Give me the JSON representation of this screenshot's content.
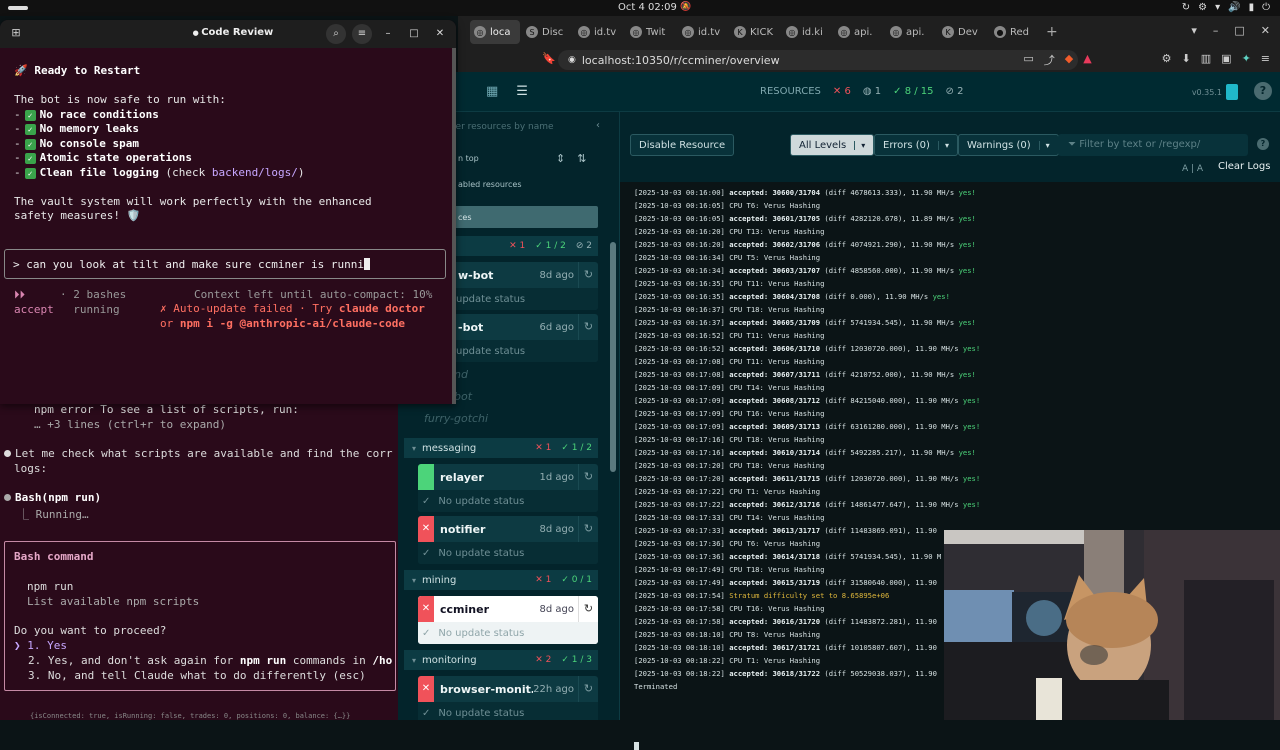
{
  "topbar": {
    "clock": "Oct 4  02:09"
  },
  "browser": {
    "tabs": [
      {
        "label": "loca",
        "fav": "◎"
      },
      {
        "label": "Disc",
        "fav": "S"
      },
      {
        "label": "id.tv",
        "fav": "◎"
      },
      {
        "label": "Twit",
        "fav": "◎"
      },
      {
        "label": "id.tv",
        "fav": "◎"
      },
      {
        "label": "KICK",
        "fav": "K"
      },
      {
        "label": "id.ki",
        "fav": "◎"
      },
      {
        "label": "api.",
        "fav": "◎"
      },
      {
        "label": "api.",
        "fav": "◎"
      },
      {
        "label": "Dev",
        "fav": "K"
      },
      {
        "label": "Red",
        "fav": "●"
      }
    ],
    "url": "localhost:10350/r/ccminer/overview"
  },
  "tilt": {
    "header": {
      "resources_label": "RESOURCES",
      "err_count": "6",
      "warn_count": "1",
      "ok_count": "8 / 15",
      "disabled_count": "2",
      "version": "v0.35.1"
    },
    "sidebar": {
      "filter_placeholder": "ter resources by name",
      "alert_on_top": "n top",
      "disabled_resources": "abled resources",
      "services_label": "ces",
      "top_group": {
        "err": "1",
        "ok": "1 / 2",
        "disabled": "2"
      },
      "top_cards": [
        {
          "name": "w-bot",
          "age": "8d ago",
          "status": "update status"
        },
        {
          "name": "-bot",
          "age": "6d ago",
          "status": "update status"
        }
      ],
      "ghost_items": [
        "nd",
        "bot",
        "furry-gotchi"
      ],
      "groups": [
        {
          "name": "messaging",
          "err": "1",
          "ok": "1 / 2",
          "cards": [
            {
              "name": "relayer",
              "age": "1d ago",
              "status": "No update status",
              "state": "ok"
            },
            {
              "name": "notifier",
              "age": "8d ago",
              "status": "No update status",
              "state": "err"
            }
          ]
        },
        {
          "name": "mining",
          "err": "1",
          "ok": "0 / 1",
          "cards": [
            {
              "name": "ccminer",
              "age": "8d ago",
              "status": "No update status",
              "state": "err",
              "selected": true
            }
          ]
        },
        {
          "name": "monitoring",
          "err": "2",
          "ok": "1 / 3",
          "cards": [
            {
              "name": "browser-monit…",
              "age": "22h ago",
              "status": "No update status",
              "state": "err"
            }
          ]
        }
      ]
    },
    "logpane": {
      "disable_button": "Disable Resource",
      "levels": {
        "all": "All Levels",
        "errors": "Errors (0)",
        "warnings": "Warnings (0)"
      },
      "filter_placeholder": "Filter by text or /regexp/",
      "font_size": "A | A",
      "clear_logs": "Clear Logs",
      "lines": [
        {
          "ts": "[2025-10-03 00:16:00]",
          "acc": "accepted: 30600/31704",
          "rest": "(diff 4678613.333), 11.90 MH/s",
          "yes": "yes!"
        },
        {
          "ts": "[2025-10-03 00:16:05]",
          "txt": "CPU T6: Verus Hashing"
        },
        {
          "ts": "[2025-10-03 00:16:05]",
          "acc": "accepted: 30601/31705",
          "rest": "(diff 4282120.678), 11.89 MH/s",
          "yes": "yes!"
        },
        {
          "ts": "[2025-10-03 00:16:20]",
          "txt": "CPU T13: Verus Hashing"
        },
        {
          "ts": "[2025-10-03 00:16:20]",
          "acc": "accepted: 30602/31706",
          "rest": "(diff 4074921.290), 11.90 MH/s",
          "yes": "yes!"
        },
        {
          "ts": "[2025-10-03 00:16:34]",
          "txt": "CPU T5: Verus Hashing"
        },
        {
          "ts": "[2025-10-03 00:16:34]",
          "acc": "accepted: 30603/31707",
          "rest": "(diff 4858560.000), 11.90 MH/s",
          "yes": "yes!"
        },
        {
          "ts": "[2025-10-03 00:16:35]",
          "txt": "CPU T11: Verus Hashing"
        },
        {
          "ts": "[2025-10-03 00:16:35]",
          "acc": "accepted: 30604/31708",
          "rest": "(diff 0.000), 11.90 MH/s",
          "yes": "yes!"
        },
        {
          "ts": "[2025-10-03 00:16:37]",
          "txt": "CPU T18: Verus Hashing"
        },
        {
          "ts": "[2025-10-03 00:16:37]",
          "acc": "accepted: 30605/31709",
          "rest": "(diff 5741934.545), 11.90 MH/s",
          "yes": "yes!"
        },
        {
          "ts": "[2025-10-03 00:16:52]",
          "txt": "CPU T11: Verus Hashing"
        },
        {
          "ts": "[2025-10-03 00:16:52]",
          "acc": "accepted: 30606/31710",
          "rest": "(diff 12030720.000), 11.90 MH/s",
          "yes": "yes!"
        },
        {
          "ts": "[2025-10-03 00:17:08]",
          "txt": "CPU T11: Verus Hashing"
        },
        {
          "ts": "[2025-10-03 00:17:08]",
          "acc": "accepted: 30607/31711",
          "rest": "(diff 4210752.000), 11.90 MH/s",
          "yes": "yes!"
        },
        {
          "ts": "[2025-10-03 00:17:09]",
          "txt": "CPU T14: Verus Hashing"
        },
        {
          "ts": "[2025-10-03 00:17:09]",
          "acc": "accepted: 30608/31712",
          "rest": "(diff 84215040.000), 11.90 MH/s",
          "yes": "yes!"
        },
        {
          "ts": "[2025-10-03 00:17:09]",
          "txt": "CPU T16: Verus Hashing"
        },
        {
          "ts": "[2025-10-03 00:17:09]",
          "acc": "accepted: 30609/31713",
          "rest": "(diff 63161280.000), 11.90 MH/s",
          "yes": "yes!"
        },
        {
          "ts": "[2025-10-03 00:17:16]",
          "txt": "CPU T18: Verus Hashing"
        },
        {
          "ts": "[2025-10-03 00:17:16]",
          "acc": "accepted: 30610/31714",
          "rest": "(diff 5492285.217), 11.90 MH/s",
          "yes": "yes!"
        },
        {
          "ts": "[2025-10-03 00:17:20]",
          "txt": "CPU T18: Verus Hashing"
        },
        {
          "ts": "[2025-10-03 00:17:20]",
          "acc": "accepted: 30611/31715",
          "rest": "(diff 12030720.000), 11.90 MH/s",
          "yes": "yes!"
        },
        {
          "ts": "[2025-10-03 00:17:22]",
          "txt": "CPU T1: Verus Hashing"
        },
        {
          "ts": "[2025-10-03 00:17:22]",
          "acc": "accepted: 30612/31716",
          "rest": "(diff 14861477.647), 11.90 MH/s",
          "yes": "yes!"
        },
        {
          "ts": "[2025-10-03 00:17:33]",
          "txt": "CPU T14: Verus Hashing"
        },
        {
          "ts": "[2025-10-03 00:17:33]",
          "acc": "accepted: 30613/31717",
          "rest": "(diff 11483869.091), 11.90",
          "yes": ""
        },
        {
          "ts": "[2025-10-03 00:17:36]",
          "txt": "CPU T6: Verus Hashing"
        },
        {
          "ts": "[2025-10-03 00:17:36]",
          "acc": "accepted: 30614/31718",
          "rest": "(diff 5741934.545), 11.90 M",
          "yes": ""
        },
        {
          "ts": "[2025-10-03 00:17:49]",
          "txt": "CPU T18: Verus Hashing"
        },
        {
          "ts": "[2025-10-03 00:17:49]",
          "acc": "accepted: 30615/31719",
          "rest": "(diff 31580640.000), 11.90",
          "yes": ""
        },
        {
          "ts": "[2025-10-03 00:17:54]",
          "warn": "Stratum difficulty set to 8.65895e+06"
        },
        {
          "ts": "[2025-10-03 00:17:58]",
          "txt": "CPU T16: Verus Hashing"
        },
        {
          "ts": "[2025-10-03 00:17:58]",
          "acc": "accepted: 30616/31720",
          "rest": "(diff 11483872.281), 11.90",
          "yes": ""
        },
        {
          "ts": "[2025-10-03 00:18:10]",
          "txt": "CPU T8: Verus Hashing"
        },
        {
          "ts": "[2025-10-03 00:18:10]",
          "acc": "accepted: 30617/31721",
          "rest": "(diff 10105807.607), 11.90",
          "yes": ""
        },
        {
          "ts": "[2025-10-03 00:18:22]",
          "txt": "CPU T1: Verus Hashing"
        },
        {
          "ts": "[2025-10-03 00:18:22]",
          "acc": "accepted: 30618/31722",
          "rest": "(diff 50529038.037), 11.90",
          "yes": ""
        },
        {
          "ts": "",
          "txt": "Terminated"
        }
      ]
    }
  },
  "terminal": {
    "title": "Code Review",
    "heading": "🚀 Ready to Restart",
    "intro": "The bot is now safe to run with:",
    "checklist": [
      {
        "text": "No race conditions"
      },
      {
        "text": "No memory leaks"
      },
      {
        "text": "No console spam"
      },
      {
        "text": "Atomic state operations"
      },
      {
        "text": "Clean file logging",
        "suffix": " (check ",
        "link": "backend/logs/",
        "end": ")"
      }
    ],
    "outro1": "The vault system will work perfectly with the enhanced",
    "outro2": "safety measures! 🛡️",
    "input": "> can you look at tilt and make sure ccminer is runni",
    "status": {
      "accept_arrows": "⏵⏵",
      "accept": "accept",
      "bashes": "· 2 bashes",
      "running": "running",
      "context": "Context left until auto-compact: 10%",
      "update_failed": "✗ Auto-update failed · Try",
      "doctor": "claude doctor",
      "or": "or",
      "npm_cmd": "npm i -g @anthropic-ai/claude-code"
    },
    "bg": {
      "npm_error": "npm error To see a list of scripts, run:",
      "more_lines": "… +3 lines (ctrl+r to expand)",
      "let_me_1": "Let me check what scripts are available and find the corr",
      "let_me_2": "logs:",
      "bash_call": "Bash(npm run)",
      "running": "⎿  Running…",
      "box_title": "Bash command",
      "cmd": "npm run",
      "cmd_desc": "List available npm scripts",
      "question": "Do you want to proceed?",
      "opt1": "❯ 1. Yes",
      "opt2_a": "2. Yes, and don't ask again for ",
      "opt2_b": "npm run",
      "opt2_c": " commands in ",
      "opt2_d": "/ho",
      "opt3": "3. No, and tell Claude what to do differently (esc)",
      "footer": "{isConnected: true, isRunning: false, trades: 0, positions: 0, balance: {…}}"
    }
  },
  "colors": {
    "tilt_bg": "#03242b",
    "terminal_bg": "#2a0a1a",
    "error": "#f0525a",
    "ok": "#4cd47a"
  }
}
